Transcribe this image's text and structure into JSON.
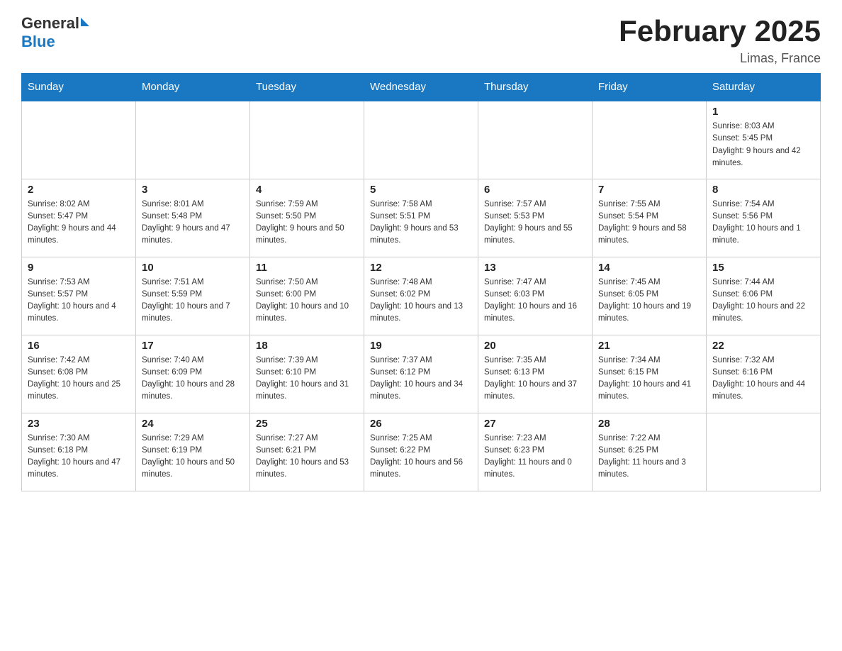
{
  "header": {
    "logo_general": "General",
    "logo_blue": "Blue",
    "month_title": "February 2025",
    "location": "Limas, France"
  },
  "days_of_week": [
    "Sunday",
    "Monday",
    "Tuesday",
    "Wednesday",
    "Thursday",
    "Friday",
    "Saturday"
  ],
  "weeks": [
    [
      {
        "day": "",
        "info": ""
      },
      {
        "day": "",
        "info": ""
      },
      {
        "day": "",
        "info": ""
      },
      {
        "day": "",
        "info": ""
      },
      {
        "day": "",
        "info": ""
      },
      {
        "day": "",
        "info": ""
      },
      {
        "day": "1",
        "info": "Sunrise: 8:03 AM\nSunset: 5:45 PM\nDaylight: 9 hours and 42 minutes."
      }
    ],
    [
      {
        "day": "2",
        "info": "Sunrise: 8:02 AM\nSunset: 5:47 PM\nDaylight: 9 hours and 44 minutes."
      },
      {
        "day": "3",
        "info": "Sunrise: 8:01 AM\nSunset: 5:48 PM\nDaylight: 9 hours and 47 minutes."
      },
      {
        "day": "4",
        "info": "Sunrise: 7:59 AM\nSunset: 5:50 PM\nDaylight: 9 hours and 50 minutes."
      },
      {
        "day": "5",
        "info": "Sunrise: 7:58 AM\nSunset: 5:51 PM\nDaylight: 9 hours and 53 minutes."
      },
      {
        "day": "6",
        "info": "Sunrise: 7:57 AM\nSunset: 5:53 PM\nDaylight: 9 hours and 55 minutes."
      },
      {
        "day": "7",
        "info": "Sunrise: 7:55 AM\nSunset: 5:54 PM\nDaylight: 9 hours and 58 minutes."
      },
      {
        "day": "8",
        "info": "Sunrise: 7:54 AM\nSunset: 5:56 PM\nDaylight: 10 hours and 1 minute."
      }
    ],
    [
      {
        "day": "9",
        "info": "Sunrise: 7:53 AM\nSunset: 5:57 PM\nDaylight: 10 hours and 4 minutes."
      },
      {
        "day": "10",
        "info": "Sunrise: 7:51 AM\nSunset: 5:59 PM\nDaylight: 10 hours and 7 minutes."
      },
      {
        "day": "11",
        "info": "Sunrise: 7:50 AM\nSunset: 6:00 PM\nDaylight: 10 hours and 10 minutes."
      },
      {
        "day": "12",
        "info": "Sunrise: 7:48 AM\nSunset: 6:02 PM\nDaylight: 10 hours and 13 minutes."
      },
      {
        "day": "13",
        "info": "Sunrise: 7:47 AM\nSunset: 6:03 PM\nDaylight: 10 hours and 16 minutes."
      },
      {
        "day": "14",
        "info": "Sunrise: 7:45 AM\nSunset: 6:05 PM\nDaylight: 10 hours and 19 minutes."
      },
      {
        "day": "15",
        "info": "Sunrise: 7:44 AM\nSunset: 6:06 PM\nDaylight: 10 hours and 22 minutes."
      }
    ],
    [
      {
        "day": "16",
        "info": "Sunrise: 7:42 AM\nSunset: 6:08 PM\nDaylight: 10 hours and 25 minutes."
      },
      {
        "day": "17",
        "info": "Sunrise: 7:40 AM\nSunset: 6:09 PM\nDaylight: 10 hours and 28 minutes."
      },
      {
        "day": "18",
        "info": "Sunrise: 7:39 AM\nSunset: 6:10 PM\nDaylight: 10 hours and 31 minutes."
      },
      {
        "day": "19",
        "info": "Sunrise: 7:37 AM\nSunset: 6:12 PM\nDaylight: 10 hours and 34 minutes."
      },
      {
        "day": "20",
        "info": "Sunrise: 7:35 AM\nSunset: 6:13 PM\nDaylight: 10 hours and 37 minutes."
      },
      {
        "day": "21",
        "info": "Sunrise: 7:34 AM\nSunset: 6:15 PM\nDaylight: 10 hours and 41 minutes."
      },
      {
        "day": "22",
        "info": "Sunrise: 7:32 AM\nSunset: 6:16 PM\nDaylight: 10 hours and 44 minutes."
      }
    ],
    [
      {
        "day": "23",
        "info": "Sunrise: 7:30 AM\nSunset: 6:18 PM\nDaylight: 10 hours and 47 minutes."
      },
      {
        "day": "24",
        "info": "Sunrise: 7:29 AM\nSunset: 6:19 PM\nDaylight: 10 hours and 50 minutes."
      },
      {
        "day": "25",
        "info": "Sunrise: 7:27 AM\nSunset: 6:21 PM\nDaylight: 10 hours and 53 minutes."
      },
      {
        "day": "26",
        "info": "Sunrise: 7:25 AM\nSunset: 6:22 PM\nDaylight: 10 hours and 56 minutes."
      },
      {
        "day": "27",
        "info": "Sunrise: 7:23 AM\nSunset: 6:23 PM\nDaylight: 11 hours and 0 minutes."
      },
      {
        "day": "28",
        "info": "Sunrise: 7:22 AM\nSunset: 6:25 PM\nDaylight: 11 hours and 3 minutes."
      },
      {
        "day": "",
        "info": ""
      }
    ]
  ]
}
